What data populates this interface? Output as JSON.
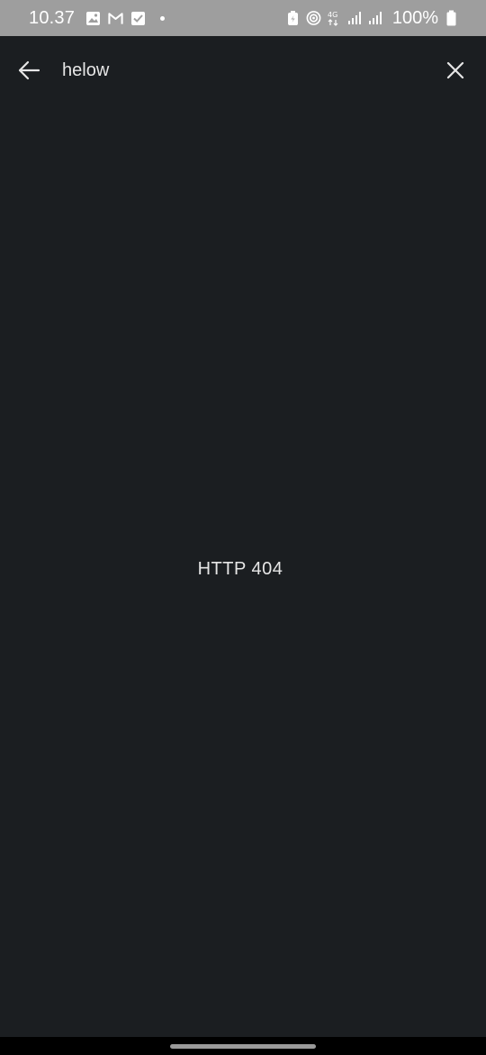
{
  "status_bar": {
    "time": "10.37",
    "battery": "100%",
    "network": "4G",
    "icons": [
      "image-notification-icon",
      "gmail-icon",
      "checkbox-icon",
      "notification-dot-icon",
      "battery-saver-icon",
      "hotspot-icon",
      "network-4g-icon",
      "signal-icon",
      "signal-icon",
      "battery-icon"
    ]
  },
  "search": {
    "query": "helow",
    "back_icon": "arrow-back-icon",
    "clear_icon": "close-icon"
  },
  "content": {
    "message": "HTTP 404"
  },
  "colors": {
    "background": "#1b1e21",
    "status_bar": "#9e9e9e",
    "text": "#e6e6e6"
  }
}
